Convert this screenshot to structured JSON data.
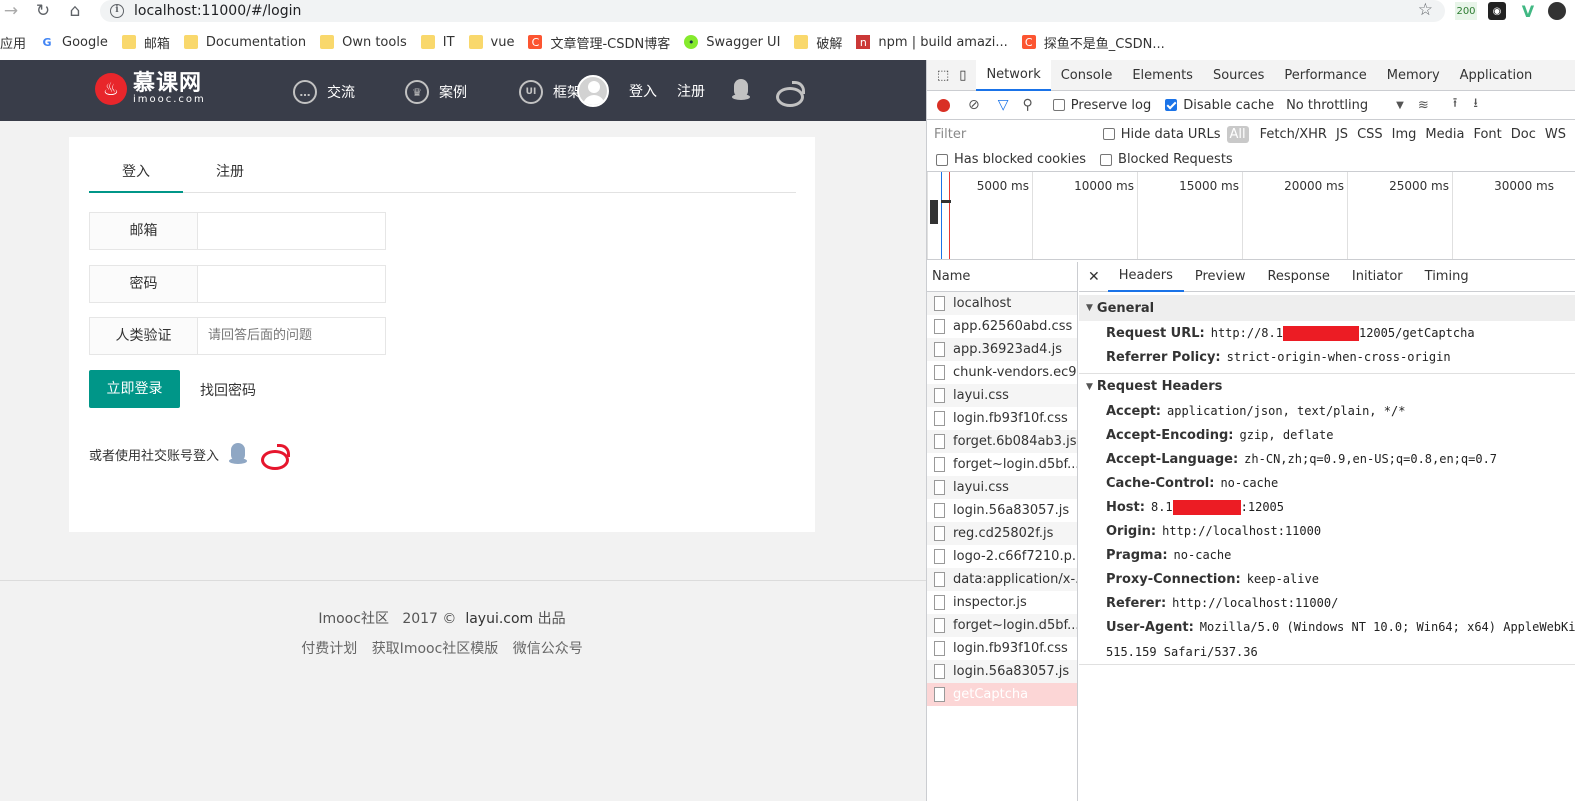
{
  "browser": {
    "url": "localhost:11000/#/login",
    "ext_badge": "200",
    "bookmarks": [
      {
        "label": "应用",
        "icon": "apps-icon"
      },
      {
        "label": "Google",
        "icon": "google-icon"
      },
      {
        "label": "邮箱",
        "icon": "folder-icon"
      },
      {
        "label": "Documentation",
        "icon": "folder-icon"
      },
      {
        "label": "Own tools",
        "icon": "folder-icon"
      },
      {
        "label": "IT",
        "icon": "folder-icon"
      },
      {
        "label": "vue",
        "icon": "folder-icon"
      },
      {
        "label": "文章管理-CSDN博客",
        "icon": "csdn-icon"
      },
      {
        "label": "Swagger UI",
        "icon": "swagger-icon"
      },
      {
        "label": "破解",
        "icon": "folder-icon"
      },
      {
        "label": "npm | build amazi...",
        "icon": "npm-icon"
      },
      {
        "label": "探鱼不是鱼_CSDN...",
        "icon": "csdn-icon"
      }
    ]
  },
  "site": {
    "logo_cn": "慕课网",
    "logo_en": "imooc.com",
    "nav": {
      "exchange": "交流",
      "cases": "案例",
      "framework": "框架"
    },
    "login_link": "登入",
    "register_link": "注册",
    "tabs": {
      "login": "登入",
      "register": "注册"
    },
    "fields": {
      "email_label": "邮箱",
      "password_label": "密码",
      "captcha_label": "人类验证",
      "captcha_placeholder": "请回答后面的问题"
    },
    "login_button": "立即登录",
    "forgot_link": "找回密码",
    "social_text": "或者使用社交账号登入",
    "footer": {
      "community": "Imooc社区",
      "year": "2017 ©",
      "layui": "layui.com",
      "made": "出品",
      "links": [
        "付费计划",
        "获取Imooc社区模版",
        "微信公众号"
      ]
    },
    "colors": {
      "accent": "#009688",
      "nav_bg": "#393d49"
    }
  },
  "devtools": {
    "tabs": [
      "Network",
      "Console",
      "Elements",
      "Sources",
      "Performance",
      "Memory",
      "Application"
    ],
    "active_tab": "Network",
    "preserve_log": "Preserve log",
    "disable_cache": "Disable cache",
    "throttling": "No throttling",
    "filter_placeholder": "Filter",
    "hide_data_urls": "Hide data URLs",
    "types": [
      "All",
      "Fetch/XHR",
      "JS",
      "CSS",
      "Img",
      "Media",
      "Font",
      "Doc",
      "WS"
    ],
    "has_blocked_cookies": "Has blocked cookies",
    "blocked_requests": "Blocked Requests",
    "timeline_ticks": [
      "5000 ms",
      "10000 ms",
      "15000 ms",
      "20000 ms",
      "25000 ms",
      "30000 ms"
    ],
    "name_header": "Name",
    "requests": [
      "localhost",
      "app.62560abd.css",
      "app.36923ad4.js",
      "chunk-vendors.ec9...",
      "layui.css",
      "login.fb93f10f.css",
      "forget.6b084ab3.js",
      "forget~login.d5bf...",
      "layui.css",
      "login.56a83057.js",
      "reg.cd25802f.js",
      "logo-2.c66f7210.p...",
      "data:application/x-...",
      "inspector.js",
      "forget~login.d5bf...",
      "login.fb93f10f.css",
      "login.56a83057.js",
      "getCaptcha"
    ],
    "detail_tabs": [
      "Headers",
      "Preview",
      "Response",
      "Initiator",
      "Timing"
    ],
    "general_title": "General",
    "request_url_key": "Request URL:",
    "request_url_pre": "http://8.1",
    "request_url_post": "12005/getCaptcha",
    "referrer_policy_key": "Referrer Policy:",
    "referrer_policy_val": "strict-origin-when-cross-origin",
    "request_headers_title": "Request Headers",
    "headers": [
      {
        "k": "Accept:",
        "v": "application/json, text/plain, */*"
      },
      {
        "k": "Accept-Encoding:",
        "v": "gzip, deflate"
      },
      {
        "k": "Accept-Language:",
        "v": "zh-CN,zh;q=0.9,en-US;q=0.8,en;q=0.7"
      },
      {
        "k": "Cache-Control:",
        "v": "no-cache"
      }
    ],
    "host_key": "Host:",
    "host_pre": "8.1",
    "host_post": ":12005",
    "headers2": [
      {
        "k": "Origin:",
        "v": "http://localhost:11000"
      },
      {
        "k": "Pragma:",
        "v": "no-cache"
      },
      {
        "k": "Proxy-Connection:",
        "v": "keep-alive"
      },
      {
        "k": "Referer:",
        "v": "http://localhost:11000/"
      }
    ],
    "ua_key": "User-Agent:",
    "ua_val": "Mozilla/5.0 (Windows NT 10.0; Win64; x64) AppleWebKit",
    "ua_val2": "515.159 Safari/537.36"
  }
}
